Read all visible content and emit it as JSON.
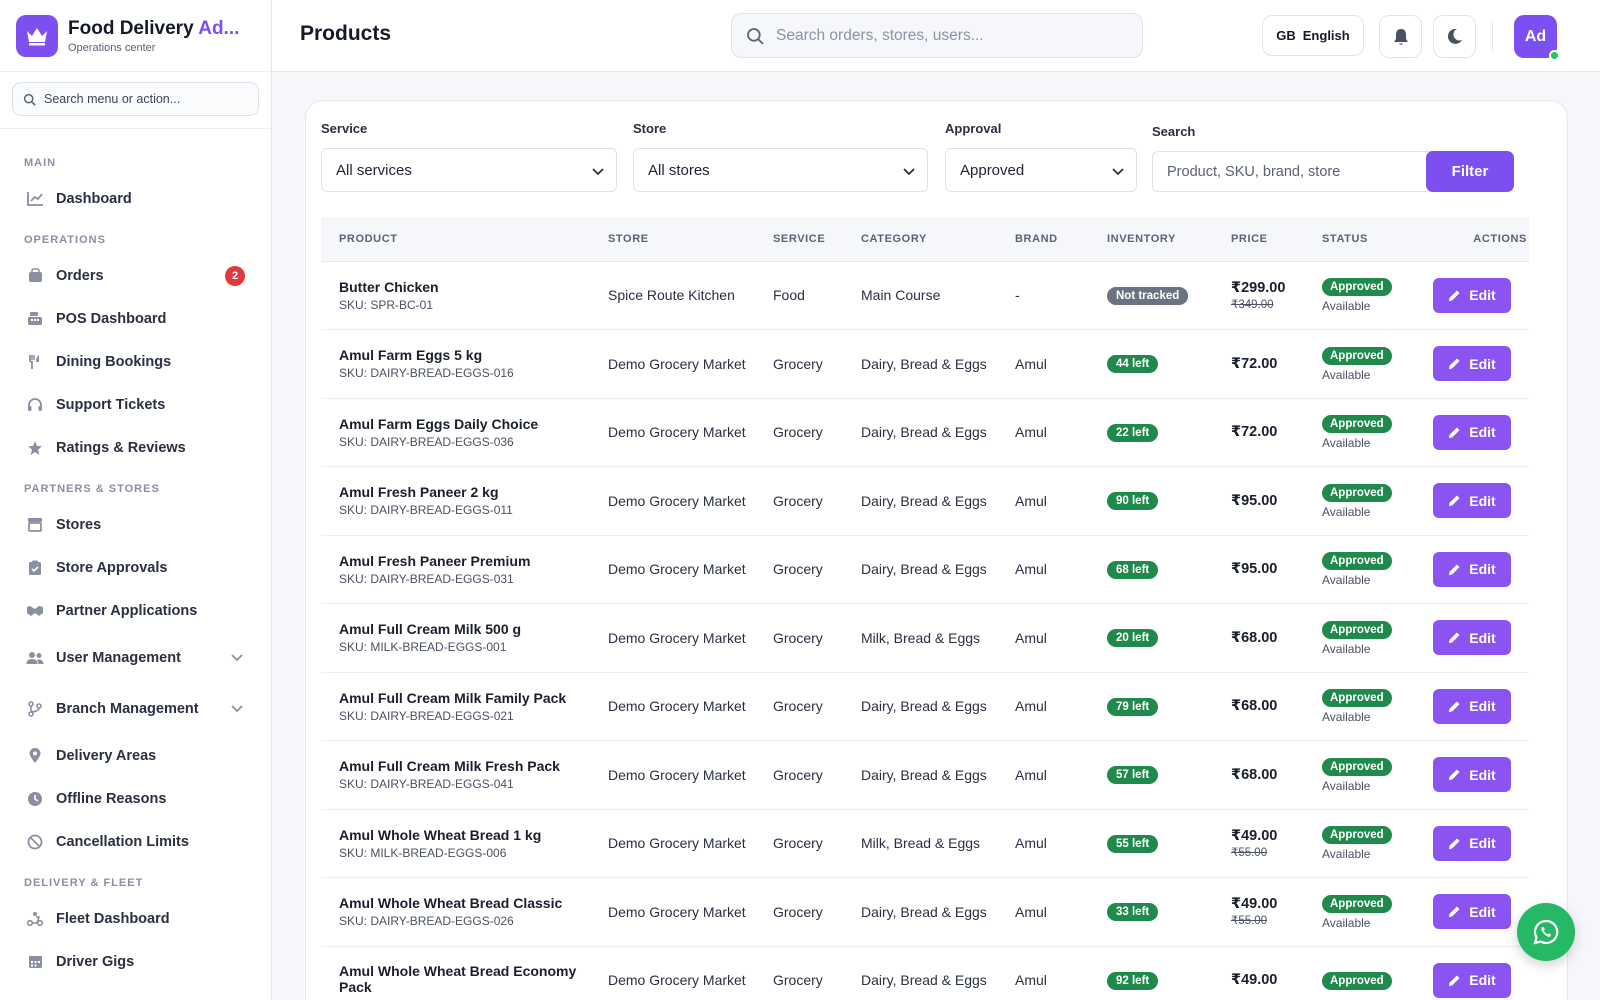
{
  "brand": {
    "title_main": "Food Delivery ",
    "title_accent": "Ad...",
    "subtitle": "Operations center"
  },
  "sidebar": {
    "search_placeholder": "Search menu or action...",
    "sections": {
      "main": "MAIN",
      "operations": "OPERATIONS",
      "partners": "PARTNERS & STORES",
      "delivery": "DELIVERY & FLEET"
    },
    "items": {
      "dashboard": "Dashboard",
      "orders": "Orders",
      "orders_badge": "2",
      "pos": "POS Dashboard",
      "dining": "Dining Bookings",
      "support": "Support Tickets",
      "ratings": "Ratings & Reviews",
      "stores": "Stores",
      "store_approvals": "Store Approvals",
      "partner_apps": "Partner Applications",
      "user_mgmt": "User Management",
      "branch_mgmt": "Branch Management",
      "delivery_areas": "Delivery Areas",
      "offline_reasons": "Offline Reasons",
      "cancel_limits": "Cancellation Limits",
      "fleet": "Fleet Dashboard",
      "driver_gigs": "Driver Gigs"
    }
  },
  "header": {
    "title": "Products",
    "search_placeholder": "Search orders, stores, users...",
    "lang_flag": "GB",
    "lang_label": "English",
    "avatar": "Ad"
  },
  "filters": {
    "service_label": "Service",
    "service_value": "All services",
    "store_label": "Store",
    "store_value": "All stores",
    "approval_label": "Approval",
    "approval_value": "Approved",
    "search_label": "Search",
    "search_placeholder": "Product, SKU, brand, store",
    "filter_button": "Filter"
  },
  "table": {
    "columns": [
      "PRODUCT",
      "STORE",
      "SERVICE",
      "CATEGORY",
      "BRAND",
      "INVENTORY",
      "PRICE",
      "STATUS",
      "ACTIONS"
    ],
    "edit_label": "Edit",
    "rows": [
      {
        "name": "Butter Chicken",
        "sku": "SKU: SPR-BC-01",
        "store": "Spice Route Kitchen",
        "service": "Food",
        "category": "Main Course",
        "brand": "-",
        "inventory": "Not tracked",
        "price": "₹299.00",
        "old_price": "₹349.00",
        "status": "Approved",
        "availability": "Available"
      },
      {
        "name": "Amul Farm Eggs 5 kg",
        "sku": "SKU: DAIRY-BREAD-EGGS-016",
        "store": "Demo Grocery Market",
        "service": "Grocery",
        "category": "Dairy, Bread & Eggs",
        "brand": "Amul",
        "inventory": "44 left",
        "price": "₹72.00",
        "old_price": "",
        "status": "Approved",
        "availability": "Available"
      },
      {
        "name": "Amul Farm Eggs Daily Choice",
        "sku": "SKU: DAIRY-BREAD-EGGS-036",
        "store": "Demo Grocery Market",
        "service": "Grocery",
        "category": "Dairy, Bread & Eggs",
        "brand": "Amul",
        "inventory": "22 left",
        "price": "₹72.00",
        "old_price": "",
        "status": "Approved",
        "availability": "Available"
      },
      {
        "name": "Amul Fresh Paneer 2 kg",
        "sku": "SKU: DAIRY-BREAD-EGGS-011",
        "store": "Demo Grocery Market",
        "service": "Grocery",
        "category": "Dairy, Bread & Eggs",
        "brand": "Amul",
        "inventory": "90 left",
        "price": "₹95.00",
        "old_price": "",
        "status": "Approved",
        "availability": "Available"
      },
      {
        "name": "Amul Fresh Paneer Premium",
        "sku": "SKU: DAIRY-BREAD-EGGS-031",
        "store": "Demo Grocery Market",
        "service": "Grocery",
        "category": "Dairy, Bread & Eggs",
        "brand": "Amul",
        "inventory": "68 left",
        "price": "₹95.00",
        "old_price": "",
        "status": "Approved",
        "availability": "Available"
      },
      {
        "name": "Amul Full Cream Milk 500 g",
        "sku": "SKU: MILK-BREAD-EGGS-001",
        "store": "Demo Grocery Market",
        "service": "Grocery",
        "category": "Milk, Bread & Eggs",
        "brand": "Amul",
        "inventory": "20 left",
        "price": "₹68.00",
        "old_price": "",
        "status": "Approved",
        "availability": "Available"
      },
      {
        "name": "Amul Full Cream Milk Family Pack",
        "sku": "SKU: DAIRY-BREAD-EGGS-021",
        "store": "Demo Grocery Market",
        "service": "Grocery",
        "category": "Dairy, Bread & Eggs",
        "brand": "Amul",
        "inventory": "79 left",
        "price": "₹68.00",
        "old_price": "",
        "status": "Approved",
        "availability": "Available"
      },
      {
        "name": "Amul Full Cream Milk Fresh Pack",
        "sku": "SKU: DAIRY-BREAD-EGGS-041",
        "store": "Demo Grocery Market",
        "service": "Grocery",
        "category": "Dairy, Bread & Eggs",
        "brand": "Amul",
        "inventory": "57 left",
        "price": "₹68.00",
        "old_price": "",
        "status": "Approved",
        "availability": "Available"
      },
      {
        "name": "Amul Whole Wheat Bread 1 kg",
        "sku": "SKU: MILK-BREAD-EGGS-006",
        "store": "Demo Grocery Market",
        "service": "Grocery",
        "category": "Milk, Bread & Eggs",
        "brand": "Amul",
        "inventory": "55 left",
        "price": "₹49.00",
        "old_price": "₹55.00",
        "status": "Approved",
        "availability": "Available"
      },
      {
        "name": "Amul Whole Wheat Bread Classic",
        "sku": "SKU: DAIRY-BREAD-EGGS-026",
        "store": "Demo Grocery Market",
        "service": "Grocery",
        "category": "Dairy, Bread & Eggs",
        "brand": "Amul",
        "inventory": "33 left",
        "price": "₹49.00",
        "old_price": "₹55.00",
        "status": "Approved",
        "availability": "Available"
      },
      {
        "name": "Amul Whole Wheat Bread Economy Pack",
        "sku": "",
        "store": "Demo Grocery Market",
        "service": "Grocery",
        "category": "Dairy, Bread & Eggs",
        "brand": "Amul",
        "inventory": "92 left",
        "price": "₹49.00",
        "old_price": "",
        "status": "Approved",
        "availability": ""
      }
    ]
  },
  "colors": {
    "accent": "#7c4ff0",
    "success": "#1f8a4c",
    "danger": "#e5383b",
    "muted_badge": "#6b7280",
    "whatsapp": "#25b865"
  },
  "icons": {
    "brand": "crown-icon",
    "whatsapp": "whatsapp-icon",
    "bell": "bell-icon",
    "theme": "moon-icon"
  }
}
